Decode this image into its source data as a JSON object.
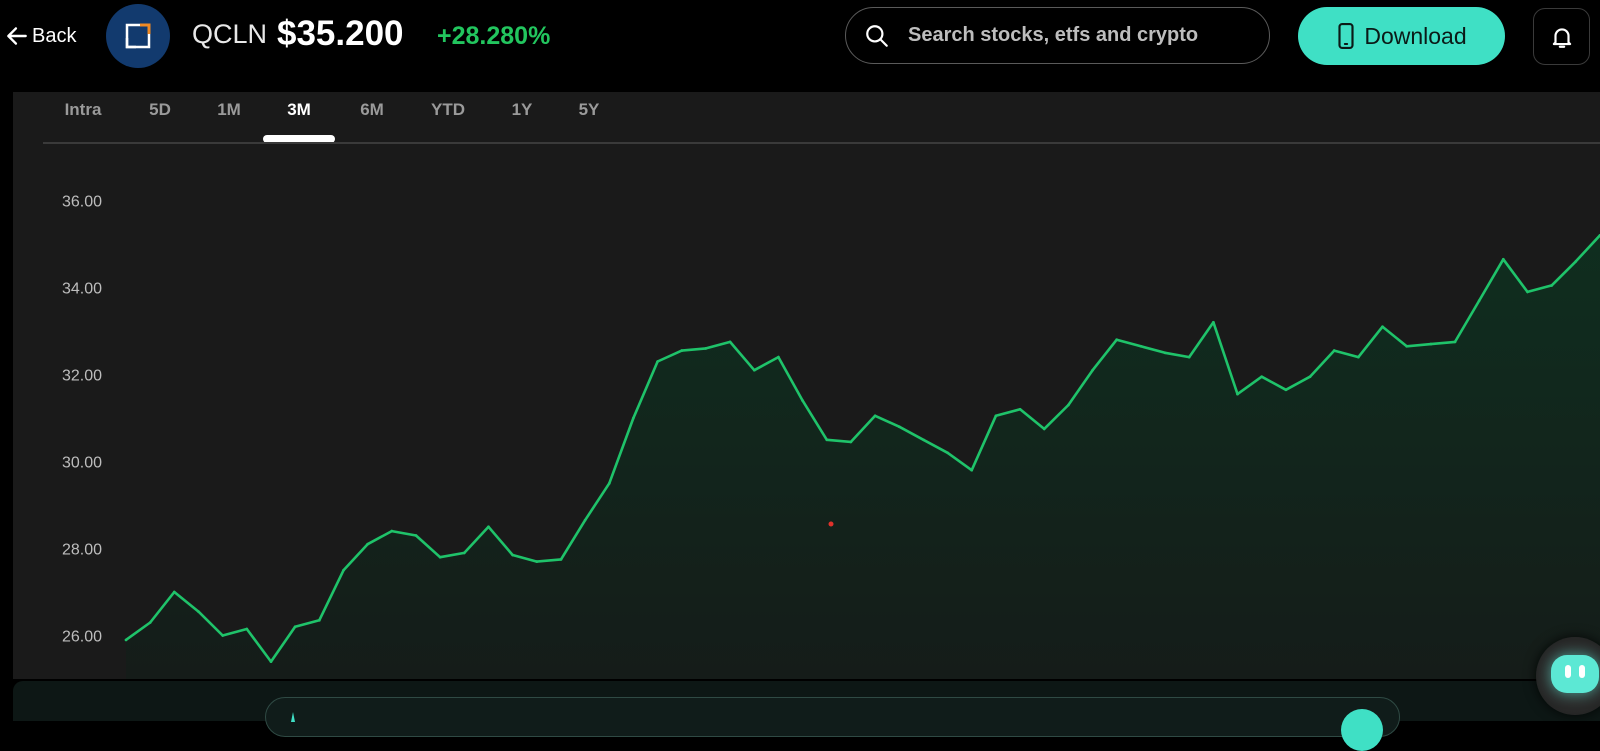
{
  "header": {
    "back_label": "Back",
    "ticker": "QCLN",
    "price": "$35.200",
    "change": "+28.280%",
    "search": {
      "placeholder": "Search stocks, etfs and crypto",
      "value": ""
    },
    "download_label": "Download",
    "icons": [
      "arrow-left-icon",
      "fund-logo-icon",
      "search-icon",
      "phone-icon",
      "bell-icon"
    ]
  },
  "tabs": {
    "items": [
      "Intra",
      "5D",
      "1M",
      "3M",
      "6M",
      "YTD",
      "1Y",
      "5Y"
    ],
    "active": "3M"
  },
  "chart_data": {
    "type": "area",
    "title": "",
    "xlabel": "",
    "ylabel": "",
    "ylim": [
      25.0,
      37.3
    ],
    "yticks": [
      "36.00",
      "34.00",
      "32.00",
      "30.00",
      "28.00",
      "26.00"
    ],
    "grid": false,
    "line_color": "#1fc36a",
    "fill_color": "#0f2a1d",
    "series": [
      {
        "values": [
          25.9,
          26.3,
          27.0,
          26.55,
          26.0,
          26.15,
          25.4,
          26.2,
          26.35,
          27.5,
          28.1,
          28.4,
          28.3,
          27.8,
          27.9,
          28.5,
          27.85,
          27.7,
          27.75,
          28.65,
          29.5,
          31.0,
          32.3,
          32.55,
          32.6,
          32.75,
          32.1,
          32.4,
          31.4,
          30.5,
          30.45,
          31.05,
          30.8,
          30.5,
          30.2,
          29.8,
          31.05,
          31.2,
          30.75,
          31.3,
          32.1,
          32.8,
          32.65,
          32.5,
          32.4,
          33.2,
          31.55,
          31.95,
          31.65,
          31.95,
          32.55,
          32.4,
          33.1,
          32.65,
          32.7,
          32.75,
          33.7,
          34.65,
          33.9,
          34.05,
          34.6,
          35.2
        ]
      }
    ]
  },
  "colors": {
    "accent": "#3fe0c5",
    "positive": "#22c55e",
    "chart_line": "#1fc36a",
    "panel_bg": "#1a1a1a"
  }
}
